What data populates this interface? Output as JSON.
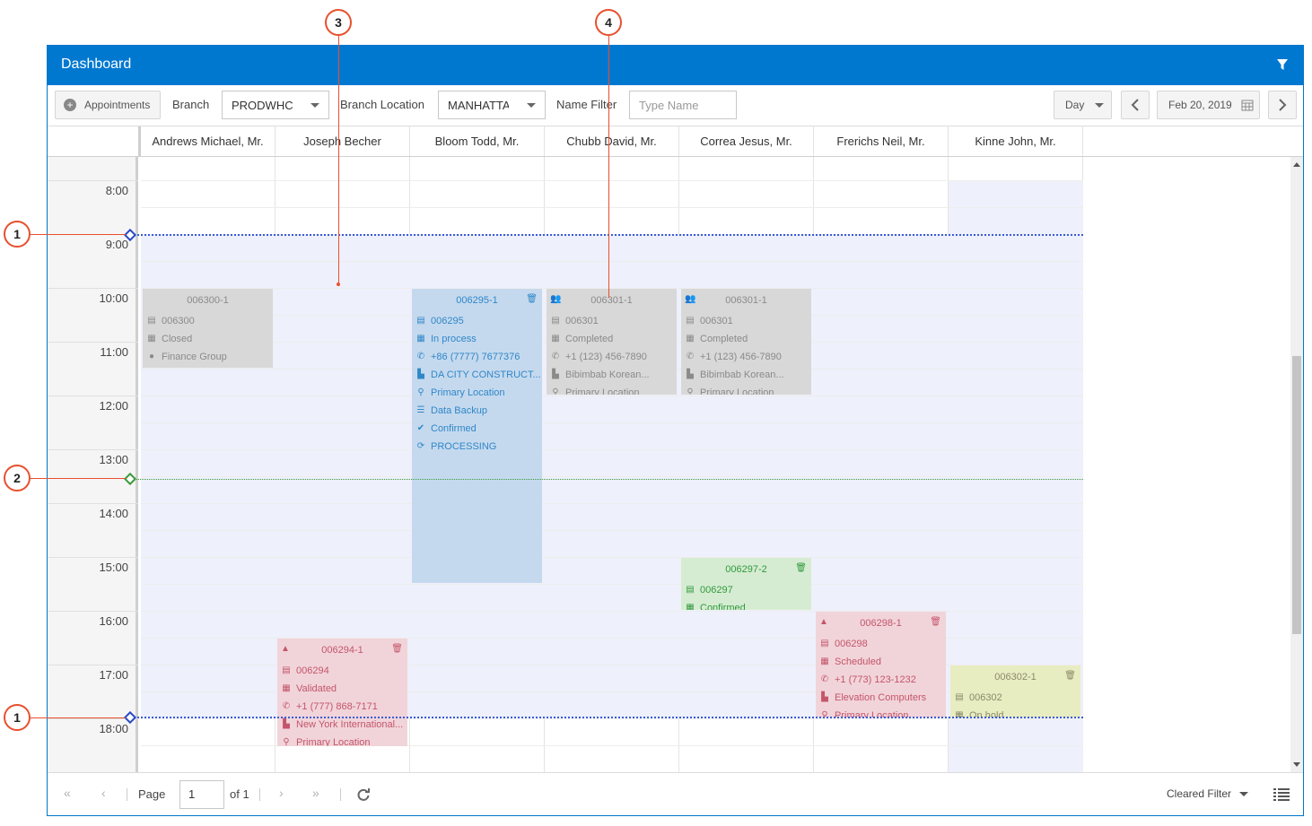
{
  "callouts": [
    "1",
    "2",
    "3",
    "4",
    "1"
  ],
  "header": {
    "title": "Dashboard",
    "filter_icon": "filter-icon"
  },
  "toolbar": {
    "appointments_label": "Appointments",
    "branch_label": "Branch",
    "branch_value": "PRODWHC",
    "branch_location_label": "Branch Location",
    "branch_location_value": "MANHATTAN",
    "name_filter_label": "Name Filter",
    "name_filter_placeholder": "Type Name",
    "view_value": "Day",
    "date_value": "Feb 20, 2019"
  },
  "columns": [
    "Andrews Michael, Mr.",
    "Joseph Becher",
    "Bloom Todd, Mr.",
    "Chubb David, Mr.",
    "Correa Jesus, Mr.",
    "Frerichs Neil, Mr.",
    "Kinne John, Mr."
  ],
  "times": [
    "8:00",
    "9:00",
    "10:00",
    "11:00",
    "12:00",
    "13:00",
    "14:00",
    "15:00",
    "16:00",
    "17:00",
    "18:00"
  ],
  "appointments": [
    {
      "id": "006300-1",
      "rows": [
        "006300",
        "Closed",
        "Finance Group"
      ],
      "color": "#d8d8d8"
    },
    {
      "id": "006294-1",
      "rows": [
        "006294",
        "Validated",
        "+1 (777) 868-7171",
        "New York International...",
        "Primary Location"
      ],
      "color": "#f1d4d9"
    },
    {
      "id": "006295-1",
      "rows": [
        "006295",
        "In process",
        "+86 (7777) 7677376",
        "DA CITY CONSTRUCT...",
        "Primary Location",
        "Data Backup",
        "Confirmed",
        "PROCESSING"
      ],
      "color": "#c5d9ee"
    },
    {
      "id": "006301-1",
      "rows": [
        "006301",
        "Completed",
        "+1 (123) 456-7890",
        "Bibimbab Korean...",
        "Primary Location"
      ],
      "color": "#d8d8d8"
    },
    {
      "id": "006301-1",
      "rows": [
        "006301",
        "Completed",
        "+1 (123) 456-7890",
        "Bibimbab Korean...",
        "Primary Location"
      ],
      "color": "#d8d8d8"
    },
    {
      "id": "006297-2",
      "rows": [
        "006297",
        "Confirmed"
      ],
      "color": "#d6ecd2"
    },
    {
      "id": "006298-1",
      "rows": [
        "006298",
        "Scheduled",
        "+1 (773) 123-1232",
        "Elevation Computers",
        "Primary Location"
      ],
      "color": "#f1d4d9"
    },
    {
      "id": "006302-1",
      "rows": [
        "006302",
        "On hold"
      ],
      "color": "#e8ecc1"
    }
  ],
  "footer": {
    "page_label": "Page",
    "page_value": "1",
    "of_label": "of 1",
    "filter_status": "Cleared Filter"
  }
}
